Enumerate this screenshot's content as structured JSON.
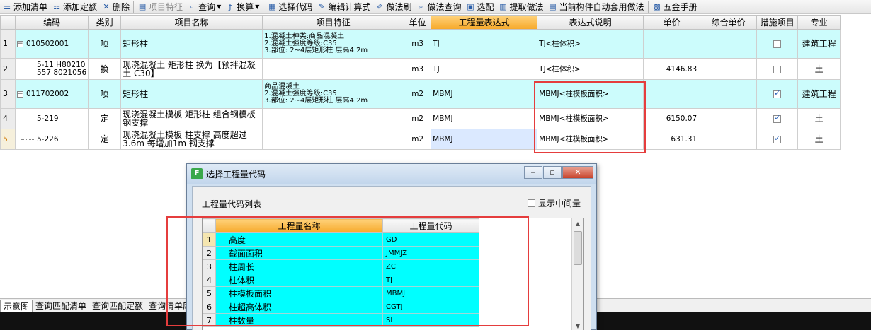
{
  "toolbar": {
    "items": [
      {
        "label": "添加清单",
        "icon": "add-list-icon"
      },
      {
        "label": "添加定额",
        "icon": "add-quota-icon"
      },
      {
        "label": "删除",
        "icon": "delete-icon"
      },
      {
        "label": "项目特征",
        "icon": "feature-icon",
        "disabled": true
      },
      {
        "label": "查询",
        "icon": "search-icon",
        "dropdown": true
      },
      {
        "label": "换算",
        "icon": "function-icon",
        "dropdown": true
      },
      {
        "label": "选择代码",
        "icon": "select-code-icon"
      },
      {
        "label": "编辑计算式",
        "icon": "edit-formula-icon"
      },
      {
        "label": "做法刷",
        "icon": "brush-icon"
      },
      {
        "label": "做法查询",
        "icon": "method-query-icon"
      },
      {
        "label": "选配",
        "icon": "match-icon"
      },
      {
        "label": "提取做法",
        "icon": "extract-icon"
      },
      {
        "label": "当前构件自动套用做法",
        "icon": "auto-apply-icon"
      },
      {
        "label": "五金手册",
        "icon": "manual-icon"
      }
    ]
  },
  "grid": {
    "headers": [
      "编码",
      "类别",
      "项目名称",
      "项目特征",
      "单位",
      "工程量表达式",
      "表达式说明",
      "单价",
      "综合单价",
      "措施项目",
      "专业"
    ],
    "rows": [
      {
        "num": "1",
        "code": "010502001",
        "tree": "minus",
        "type": "项",
        "name": "矩形柱",
        "feature": "1.混凝土种类:商品混凝土\n2.混凝土强度等级:C35\n3.部位: 2~4层矩形柱 层高4.2m",
        "unit": "m3",
        "expr": "TJ",
        "desc": "TJ<柱体积>",
        "price": "",
        "comp": "",
        "measure": false,
        "major": "建筑工程",
        "cyan": true
      },
      {
        "num": "2",
        "code": "5-11 H80210\n557 8021056",
        "tree": "leaf",
        "type": "换",
        "name": "现浇混凝土 矩形柱 换为【预拌混凝土 C30】",
        "feature": "",
        "unit": "m3",
        "expr": "TJ",
        "desc": "TJ<柱体积>",
        "price": "4146.83",
        "comp": "",
        "measure": false,
        "major": "土",
        "cyan": false
      },
      {
        "num": "3",
        "code": "011702002",
        "tree": "minus",
        "type": "项",
        "name": "矩形柱",
        "feature": "商品混凝土\n2.混凝土强度等级:C35\n3.部位: 2~4层矩形柱 层高4.2m",
        "unit": "m2",
        "expr": "MBMJ",
        "desc": "MBMJ<柱模板面积>",
        "price": "",
        "comp": "",
        "measure": true,
        "major": "建筑工程",
        "cyan": true
      },
      {
        "num": "4",
        "code": "5-219",
        "tree": "leaf",
        "type": "定",
        "name": "现浇混凝土模板 矩形柱 组合钢模板 钢支撑",
        "feature": "",
        "unit": "m2",
        "expr": "MBMJ",
        "desc": "MBMJ<柱模板面积>",
        "price": "6150.07",
        "comp": "",
        "measure": true,
        "major": "土",
        "cyan": false
      },
      {
        "num": "5",
        "code": "5-226",
        "tree": "leaf",
        "type": "定",
        "name": "现浇混凝土模板 柱支撑 高度超过3.6m 每增加1m 钢支撑",
        "feature": "",
        "unit": "m2",
        "expr": "MBMJ",
        "desc": "MBMJ<柱模板面积>",
        "price": "631.31",
        "comp": "",
        "measure": true,
        "major": "土",
        "cyan": false,
        "current": true
      }
    ]
  },
  "bottom_tabs": [
    "示意图",
    "查询匹配清单",
    "查询匹配定额",
    "查询清单库"
  ],
  "dialog": {
    "title": "选择工程量代码",
    "list_label": "工程量代码列表",
    "show_intermediate_label": "显示中间量",
    "show_intermediate_checked": false,
    "headers": [
      "工程量名称",
      "工程量代码"
    ],
    "rows": [
      {
        "num": "1",
        "name": "高度",
        "code": "GD"
      },
      {
        "num": "2",
        "name": "截面面积",
        "code": "JMMJZ"
      },
      {
        "num": "3",
        "name": "柱周长",
        "code": "ZC"
      },
      {
        "num": "4",
        "name": "柱体积",
        "code": "TJ"
      },
      {
        "num": "5",
        "name": "柱模板面积",
        "code": "MBMJ"
      },
      {
        "num": "6",
        "name": "柱超高体积",
        "code": "CGTJ"
      },
      {
        "num": "7",
        "name": "柱数量",
        "code": "SL"
      }
    ]
  },
  "colors": {
    "accent_header": "#f6a828",
    "row_cyan": "#ccfcfc",
    "list_cyan": "#00ffff",
    "annotation_red": "#e53d3d"
  }
}
